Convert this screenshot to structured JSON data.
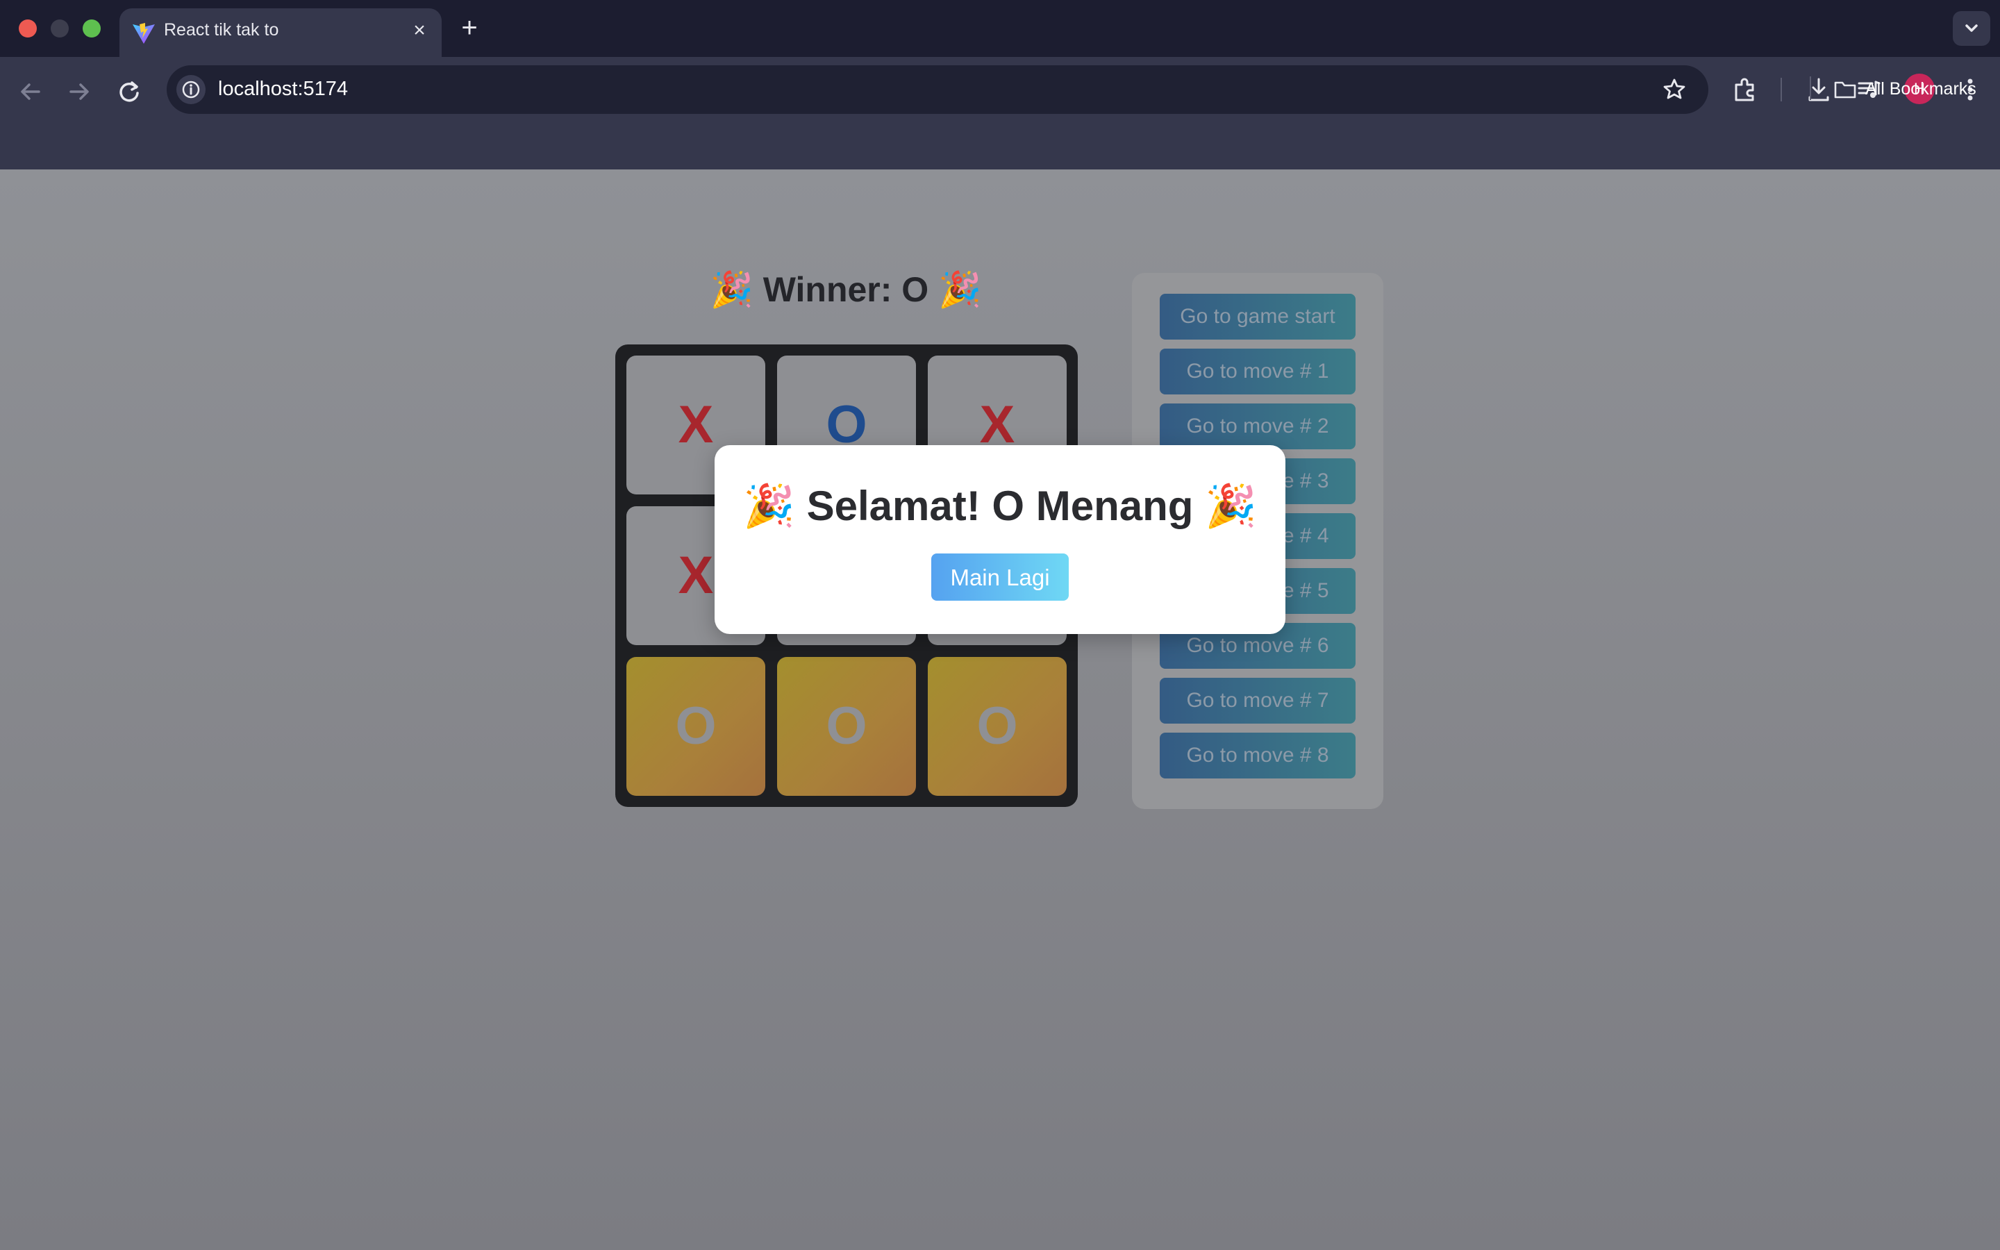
{
  "browser": {
    "tab_title": "React tik tak to",
    "url": "localhost:5174",
    "bookmarks_label": "All Bookmarks",
    "profile_initial": "H"
  },
  "game": {
    "status": "🎉 Winner: O 🎉",
    "board": [
      "X",
      "O",
      "X",
      "X",
      "",
      "",
      "O",
      "O",
      "O"
    ],
    "winning_cells": [
      6,
      7,
      8
    ]
  },
  "history": {
    "moves": [
      "Go to game start",
      "Go to move # 1",
      "Go to move # 2",
      "Go to move # 3",
      "Go to move # 4",
      "Go to move # 5",
      "Go to move # 6",
      "Go to move # 7",
      "Go to move # 8"
    ]
  },
  "modal": {
    "title": "🎉 Selamat! O Menang 🎉",
    "button_label": "Main Lagi"
  },
  "colors": {
    "x_mark": "#a8262d",
    "o_mark": "#1f4c8e",
    "win_cell": "#a48f2e",
    "modal_button": "#55a2f0"
  }
}
